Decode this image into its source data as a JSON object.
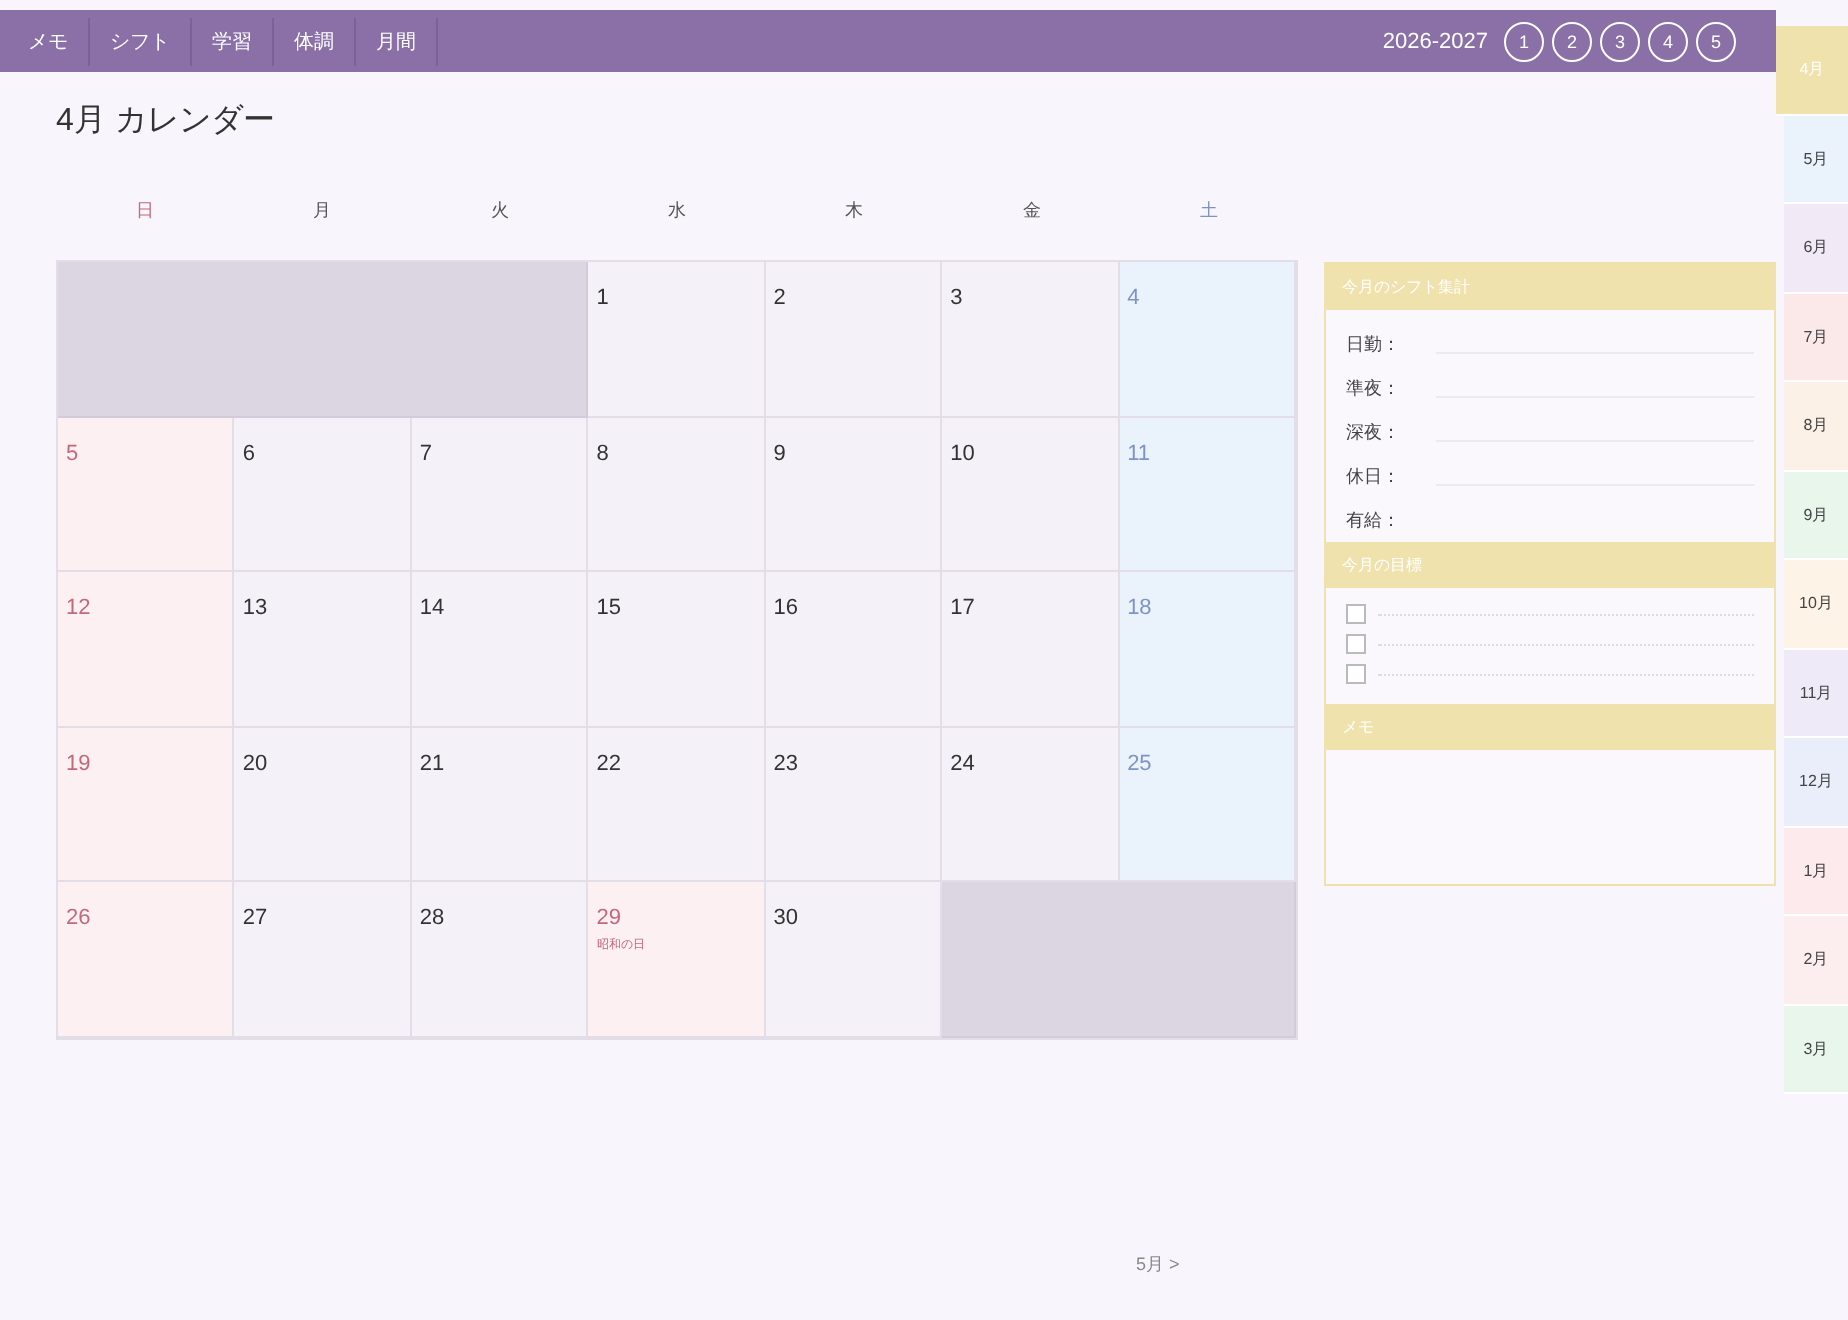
{
  "nav": {
    "items": [
      {
        "label": "メモ",
        "selected": false
      },
      {
        "label": "シフト",
        "selected": false
      },
      {
        "label": "学習",
        "selected": false
      },
      {
        "label": "体調",
        "selected": false
      },
      {
        "label": "月間",
        "selected": false
      }
    ],
    "year": "2026-2027",
    "pages": [
      "1",
      "2",
      "3",
      "4",
      "5"
    ]
  },
  "title": "4月 カレンダー",
  "weekdays": [
    {
      "label": "日",
      "kind": "sun"
    },
    {
      "label": "月",
      "kind": "weekday"
    },
    {
      "label": "火",
      "kind": "weekday"
    },
    {
      "label": "水",
      "kind": "weekday"
    },
    {
      "label": "木",
      "kind": "weekday"
    },
    {
      "label": "金",
      "kind": "weekday"
    },
    {
      "label": "土",
      "kind": "sat"
    }
  ],
  "weeks": [
    [
      {
        "kind": "blank"
      },
      {
        "kind": "blank"
      },
      {
        "kind": "blank"
      },
      {
        "kind": "weekday",
        "day": "1"
      },
      {
        "kind": "weekday",
        "day": "2"
      },
      {
        "kind": "weekday",
        "day": "3"
      },
      {
        "kind": "sat",
        "day": "4"
      }
    ],
    [
      {
        "kind": "sun",
        "day": "5"
      },
      {
        "kind": "weekday",
        "day": "6"
      },
      {
        "kind": "weekday",
        "day": "7"
      },
      {
        "kind": "weekday",
        "day": "8"
      },
      {
        "kind": "weekday",
        "day": "9"
      },
      {
        "kind": "weekday",
        "day": "10"
      },
      {
        "kind": "sat",
        "day": "11"
      }
    ],
    [
      {
        "kind": "sun",
        "day": "12"
      },
      {
        "kind": "weekday",
        "day": "13"
      },
      {
        "kind": "weekday",
        "day": "14"
      },
      {
        "kind": "weekday",
        "day": "15"
      },
      {
        "kind": "weekday",
        "day": "16"
      },
      {
        "kind": "weekday",
        "day": "17"
      },
      {
        "kind": "sat",
        "day": "18"
      }
    ],
    [
      {
        "kind": "sun",
        "day": "19"
      },
      {
        "kind": "weekday",
        "day": "20"
      },
      {
        "kind": "weekday",
        "day": "21"
      },
      {
        "kind": "weekday",
        "day": "22"
      },
      {
        "kind": "weekday",
        "day": "23"
      },
      {
        "kind": "weekday",
        "day": "24"
      },
      {
        "kind": "sat",
        "day": "25"
      }
    ],
    [
      {
        "kind": "sun",
        "day": "26"
      },
      {
        "kind": "weekday",
        "day": "27"
      },
      {
        "kind": "weekday",
        "day": "28"
      },
      {
        "kind": "holiday",
        "day": "29",
        "note": "昭和の日"
      },
      {
        "kind": "weekday",
        "day": "30"
      },
      {
        "kind": "blank"
      },
      {
        "kind": "blank"
      }
    ]
  ],
  "shift_summary": {
    "title": "今月のシフト集計",
    "rows": [
      "日勤：",
      "準夜：",
      "深夜：",
      "休日：",
      "有給："
    ]
  },
  "goals": {
    "title": "今月の目標",
    "items": [
      {
        "checked": false
      },
      {
        "checked": false
      },
      {
        "checked": false
      }
    ]
  },
  "memo": {
    "title": "メモ"
  },
  "next_link": "5月 >",
  "month_tabs": [
    {
      "label": "4月",
      "selected": true,
      "color": "#efe2ad"
    },
    {
      "label": "5月",
      "selected": false,
      "color": "#eaf2fb"
    },
    {
      "label": "6月",
      "selected": false,
      "color": "#f1eaf6"
    },
    {
      "label": "7月",
      "selected": false,
      "color": "#fbe9ea"
    },
    {
      "label": "8月",
      "selected": false,
      "color": "#fcf1e6"
    },
    {
      "label": "9月",
      "selected": false,
      "color": "#e9f6ec"
    },
    {
      "label": "10月",
      "selected": false,
      "color": "#fdf3e6"
    },
    {
      "label": "11月",
      "selected": false,
      "color": "#eeeaf8"
    },
    {
      "label": "12月",
      "selected": false,
      "color": "#e9eefa"
    },
    {
      "label": "1月",
      "selected": false,
      "color": "#fceaec"
    },
    {
      "label": "2月",
      "selected": false,
      "color": "#fcedef"
    },
    {
      "label": "3月",
      "selected": false,
      "color": "#e9f6ec"
    }
  ]
}
